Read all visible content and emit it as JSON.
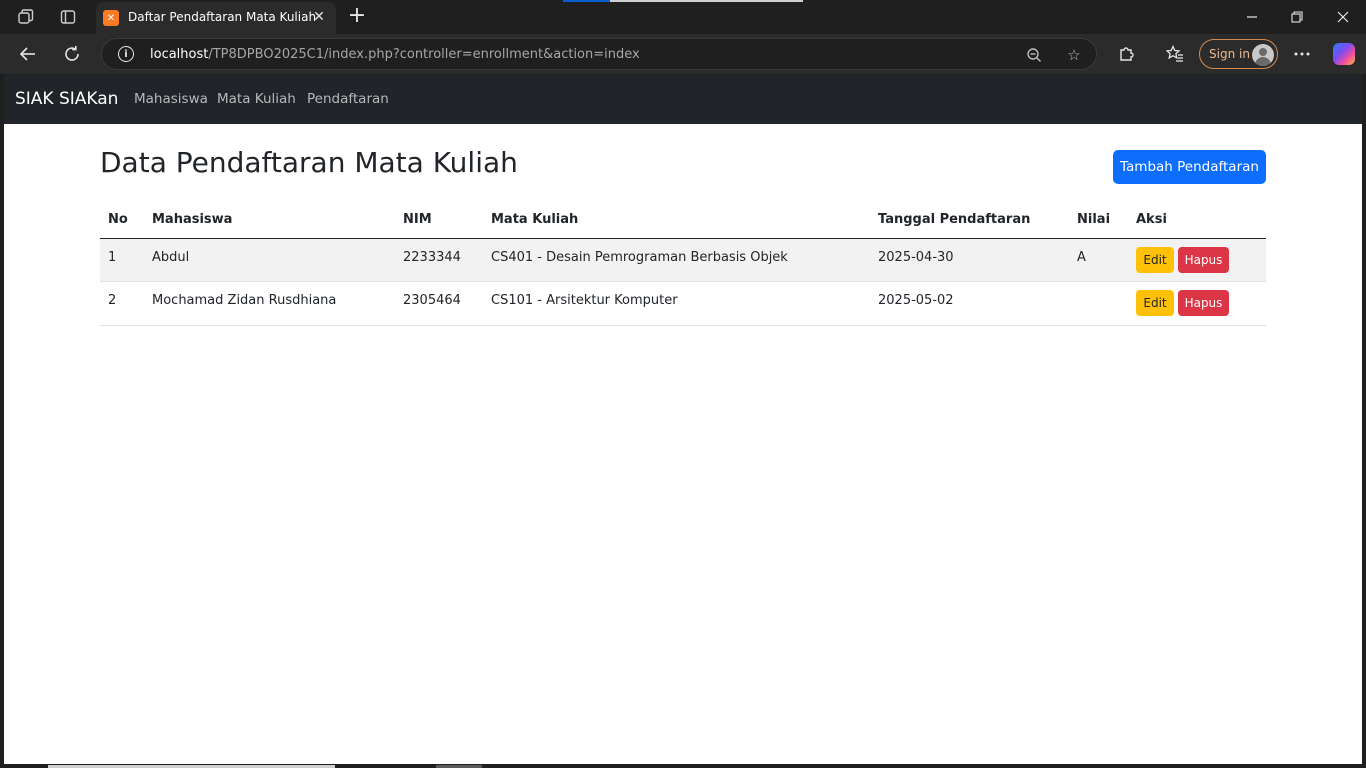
{
  "browser": {
    "tab_title": "Daftar Pendaftaran Mata Kuliah",
    "url_host": "localhost",
    "url_path": "/TP8DPBO2025C1/index.php?controller=enrollment&action=index",
    "signin_label": "Sign in",
    "icons": {
      "workspaces": "workspaces-icon",
      "tab_actions": "tab-actions-icon",
      "favicon": "xampp-icon",
      "close": "close-icon",
      "new_tab": "plus-icon",
      "back": "back-arrow-icon",
      "refresh": "refresh-icon",
      "info": "info-icon",
      "zoom": "zoom-out-icon",
      "favorite": "star-icon",
      "extensions": "puzzle-icon",
      "favorites": "favorites-icon",
      "more": "more-icon",
      "copilot": "copilot-icon"
    }
  },
  "navbar": {
    "brand": "SIAK SIAKan",
    "links": [
      "Mahasiswa",
      "Mata Kuliah",
      "Pendaftaran"
    ]
  },
  "page": {
    "title": "Data Pendaftaran Mata Kuliah",
    "add_button": "Tambah Pendaftaran"
  },
  "table": {
    "headers": [
      "No",
      "Mahasiswa",
      "NIM",
      "Mata Kuliah",
      "Tanggal Pendaftaran",
      "Nilai",
      "Aksi"
    ],
    "rows": [
      {
        "no": "1",
        "mahasiswa": "Abdul",
        "nim": "2233344",
        "mata_kuliah": "CS401 - Desain Pemrograman Berbasis Objek",
        "tanggal": "2025-04-30",
        "nilai": "A"
      },
      {
        "no": "2",
        "mahasiswa": "Mochamad Zidan Rusdhiana",
        "nim": "2305464",
        "mata_kuliah": "CS101 - Arsitektur Komputer",
        "tanggal": "2025-05-02",
        "nilai": ""
      }
    ],
    "edit_label": "Edit",
    "delete_label": "Hapus"
  },
  "colors": {
    "navbar_bg": "#212529",
    "primary": "#0d6efd",
    "warning": "#ffc107",
    "danger": "#dc3545"
  }
}
